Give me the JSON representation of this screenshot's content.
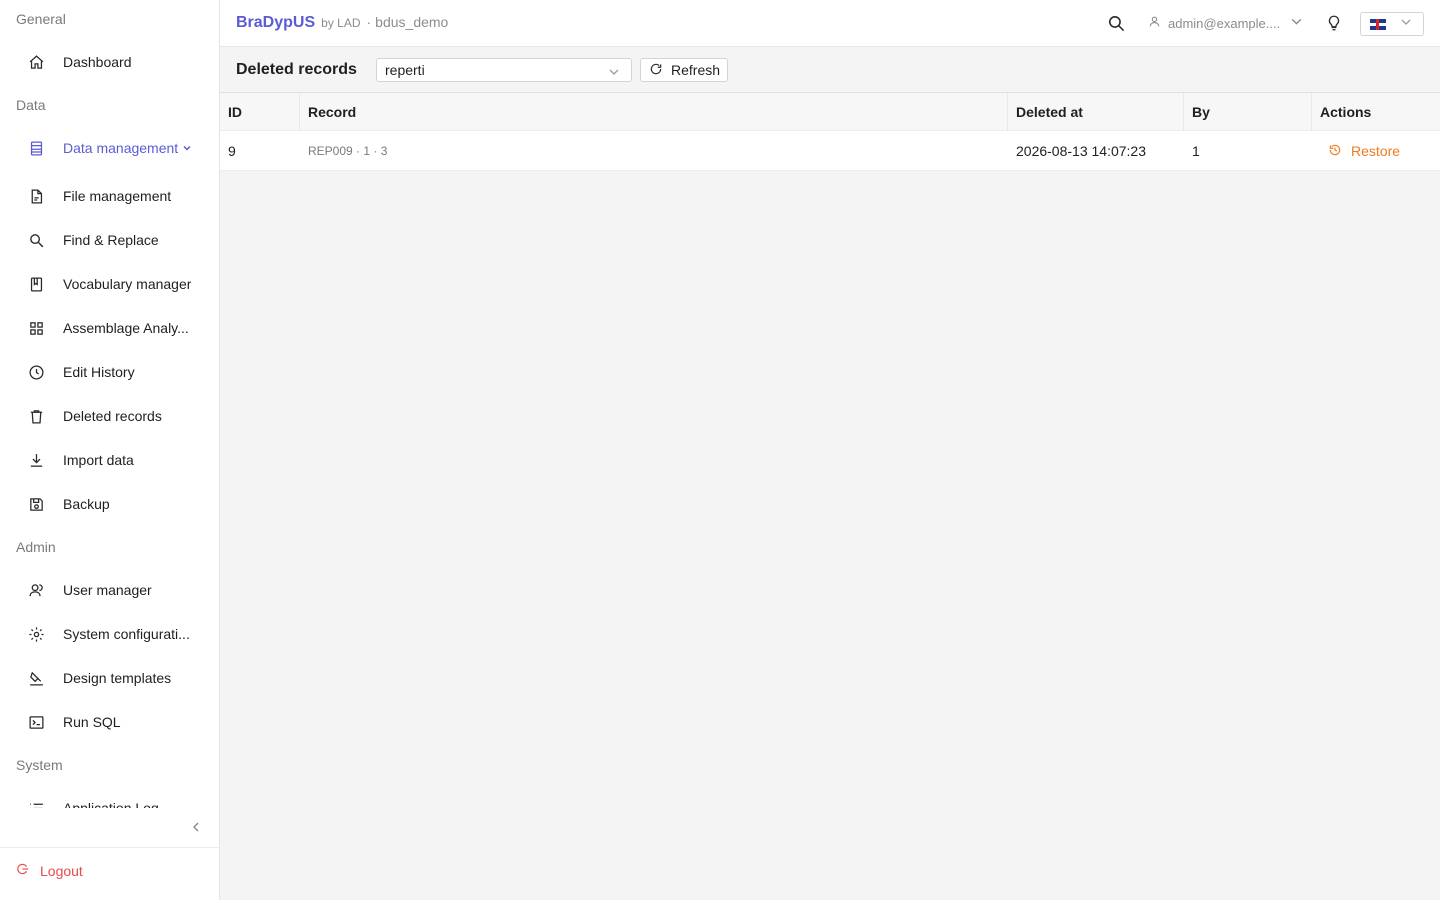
{
  "sidebar": {
    "groups": {
      "general": "General",
      "data": "Data",
      "admin": "Admin",
      "system": "System"
    },
    "items": [
      {
        "label": "Dashboard",
        "icon": "home-icon"
      },
      {
        "label": "Data management",
        "icon": "database-icon"
      },
      {
        "label": "File management",
        "icon": "file-icon"
      },
      {
        "label": "Find & Replace",
        "icon": "search-icon"
      },
      {
        "label": "Vocabulary manager",
        "icon": "book-icon"
      },
      {
        "label": "Assemblage Analy...",
        "icon": "grid-icon"
      },
      {
        "label": "Edit History",
        "icon": "history-icon"
      },
      {
        "label": "Deleted records",
        "icon": "trash-icon"
      },
      {
        "label": "Import data",
        "icon": "download-icon"
      },
      {
        "label": "Backup",
        "icon": "save-icon"
      },
      {
        "label": "User manager",
        "icon": "users-icon"
      },
      {
        "label": "System configurati...",
        "icon": "gear-icon"
      },
      {
        "label": "Design templates",
        "icon": "brush-icon"
      },
      {
        "label": "Run SQL",
        "icon": "terminal-icon"
      },
      {
        "label": "Application Log",
        "icon": "list-icon"
      }
    ],
    "logout": "Logout"
  },
  "header": {
    "brand": "BraDypUS",
    "by": "by LAD",
    "separator": "·",
    "database": "bdus_demo",
    "user": "admin@example...."
  },
  "toolbar": {
    "title": "Deleted records",
    "table_select": "reperti",
    "refresh": "Refresh"
  },
  "table": {
    "columns": [
      "ID",
      "Record",
      "Deleted at",
      "By",
      "Actions"
    ],
    "rows": [
      {
        "id": "9",
        "record": "REP009 · 1 · 3",
        "deleted_at": "2026-08-13 14:07:23",
        "by": "1",
        "action": "Restore"
      }
    ]
  },
  "colors": {
    "accent": "#5b5bd6",
    "restore": "#f07b1d",
    "logout": "#e84b4b"
  }
}
